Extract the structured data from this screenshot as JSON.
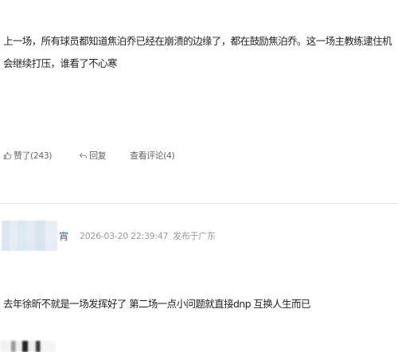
{
  "post": {
    "text": "上一场，所有球员都知道焦泊乔已经在崩溃的边缘了，都在鼓励焦泊乔。这一场主教练逮住机会继续打压，谁看了不心寒"
  },
  "actions": {
    "like": "赞了(243)",
    "reply": "回复",
    "view_comments": "查看评论(4)"
  },
  "comment": {
    "username": "宵",
    "timestamp": "2026-03-20 22:39:47",
    "location": "发布于广东",
    "text": "去年徐昕不就是一场发挥好了 第二场一点小问题就直接dnp 互换人生而已"
  }
}
